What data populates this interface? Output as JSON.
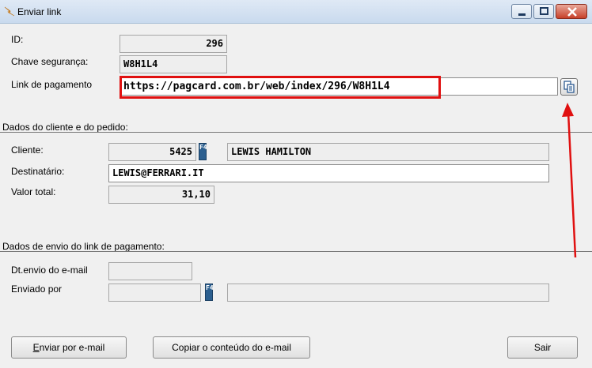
{
  "window": {
    "title": "Enviar link"
  },
  "fields": {
    "id": {
      "label": "ID:",
      "value": "296"
    },
    "chave": {
      "label": "Chave segurança:",
      "value": "W8H1L4"
    },
    "link": {
      "label": "Link de pagamento",
      "value": "https://pagcard.com.br/web/index/296/W8H1L4"
    }
  },
  "cliente_section": {
    "title": "Dados do cliente e do pedido:",
    "cliente": {
      "label": "Cliente:",
      "code": "5425",
      "name": "LEWIS HAMILTON"
    },
    "destinatario": {
      "label": "Destinatário:",
      "value": "LEWIS@FERRARI.IT"
    },
    "valor": {
      "label": "Valor total:",
      "value": "31,10"
    }
  },
  "envio_section": {
    "title": "Dados de envio do link de pagamento:",
    "dt_envio": {
      "label": "Dt.envio do e-mail",
      "value": ""
    },
    "enviado_por": {
      "label": "Enviado por",
      "code": "",
      "name": ""
    }
  },
  "f4_key": "F4",
  "buttons": {
    "enviar": {
      "mnemonic": "E",
      "rest": "nviar por e-mail"
    },
    "copiar": "Copiar o conteúdo do e-mail",
    "sair": "Sair"
  },
  "colors": {
    "highlight": "#e01010",
    "arrow": "#e01010",
    "f4_key": "#2c5f8f"
  }
}
